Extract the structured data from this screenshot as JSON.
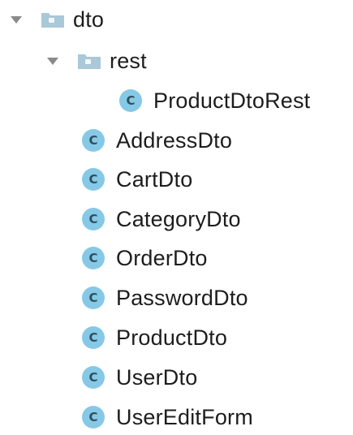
{
  "tree": {
    "root": {
      "label": "dto",
      "expanded": true,
      "icon": "folder-icon"
    },
    "subfolder": {
      "label": "rest",
      "expanded": true,
      "icon": "folder-icon"
    },
    "rest_children": [
      {
        "label": "ProductDtoRest",
        "badge": "C"
      }
    ],
    "classes": [
      {
        "label": "AddressDto",
        "badge": "C"
      },
      {
        "label": "CartDto",
        "badge": "C"
      },
      {
        "label": "CategoryDto",
        "badge": "C"
      },
      {
        "label": "OrderDto",
        "badge": "C"
      },
      {
        "label": "PasswordDto",
        "badge": "C"
      },
      {
        "label": "ProductDto",
        "badge": "C"
      },
      {
        "label": "UserDto",
        "badge": "C"
      },
      {
        "label": "UserEditForm",
        "badge": "C"
      }
    ]
  },
  "colors": {
    "class_badge": "#86c9e6",
    "folder": "#a9c8d8",
    "arrow": "#8a8a8a",
    "text": "#1d1d1d"
  }
}
